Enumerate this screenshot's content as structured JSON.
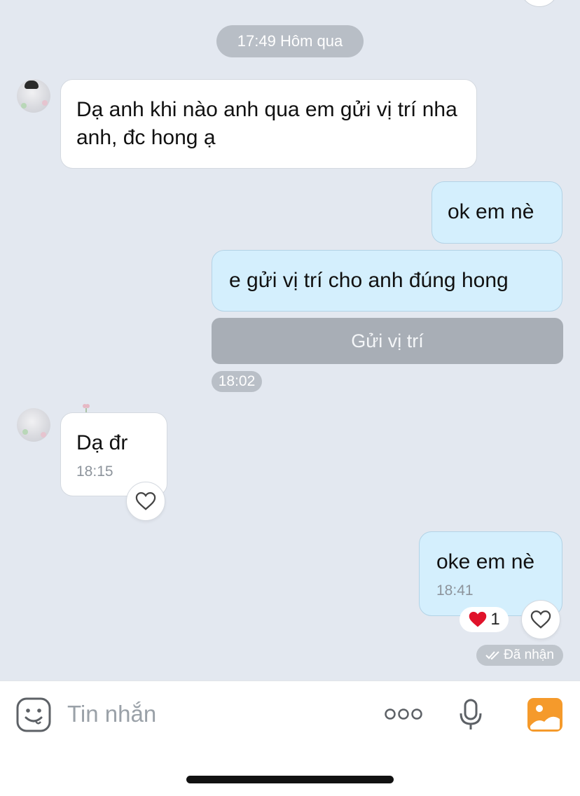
{
  "chat": {
    "date_header": "17:49 Hôm qua",
    "messages": [
      {
        "text": "Dạ anh khi nào anh qua em gửi vị trí nha anh, đc hong ạ"
      },
      {
        "text": "ok em nè"
      },
      {
        "text": "e gửi vị trí cho anh đúng hong"
      }
    ],
    "location_button": "Gửi vị trí",
    "group_time": "18:02",
    "reply_1": {
      "text": "Dạ đr",
      "time": "18:15"
    },
    "reply_2": {
      "text": "oke em nè",
      "time": "18:41",
      "reaction_count": "1"
    },
    "status": "Đã nhận"
  },
  "composer": {
    "placeholder": "Tin nhắn"
  },
  "colors": {
    "background": "#e3e8f0",
    "outgoing_bubble": "#d4effd",
    "incoming_bubble": "#ffffff",
    "accent_image_button": "#f59a2b",
    "reaction_heart": "#e0122a"
  },
  "icons": [
    "emoji-icon",
    "more-icon",
    "microphone-icon",
    "image-icon",
    "heart-icon",
    "double-check-icon"
  ]
}
